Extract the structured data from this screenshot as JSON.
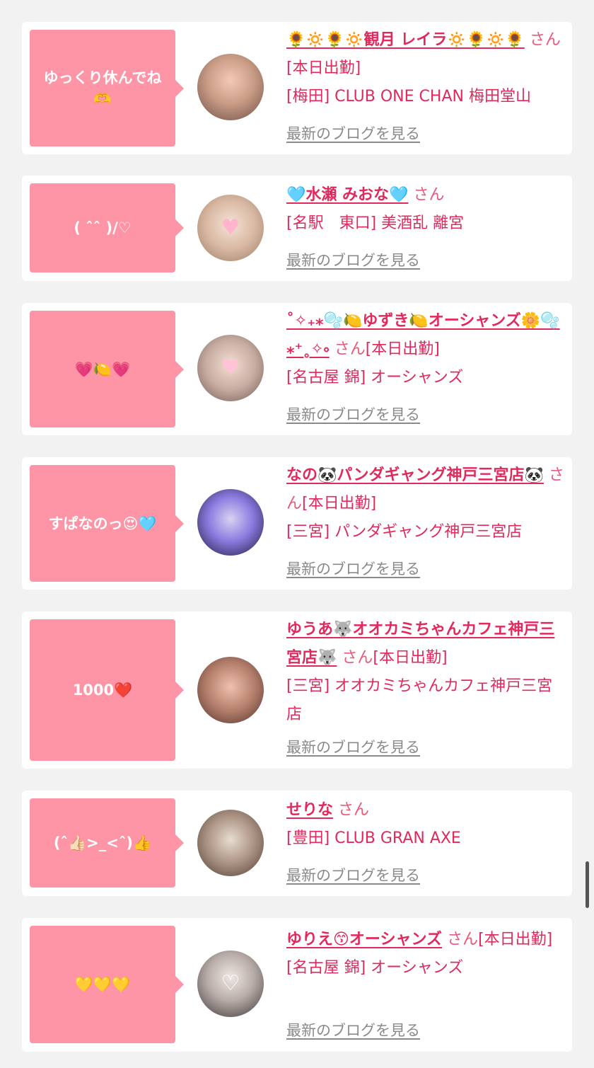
{
  "cards": [
    {
      "bubble": "ゆっくり休んでね🫶",
      "name": "🌻🔅🌻🔅観月 レイラ🔅🌻🔅🌻",
      "suffix": "さん",
      "status": "[本日出勤]",
      "shop": "[梅田] CLUB ONE CHAN 梅田堂山",
      "blog": "最新のブログを見る",
      "avatar_colors": [
        "#f3c9b6",
        "#6b4e45"
      ]
    },
    {
      "bubble": "( ˆˆ )/♡",
      "name": "🩵水瀬 みおな🩵",
      "suffix": "さん",
      "status": "",
      "shop": "[名駅　東口] 美酒乱 離宮",
      "blog": "最新のブログを見る",
      "avatar_colors": [
        "#f6e3d6",
        "#9b7a62"
      ]
    },
    {
      "bubble": "💗🍋💗",
      "name": "˚✧₊⁎🫧🍋ゆずき🍋オーシャンズ🌼🫧⁎⁺˳✧༚",
      "suffix": "さん",
      "status": "[本日出勤]",
      "shop": "[名古屋 錦] オーシャンズ",
      "blog": "最新のブログを見る",
      "avatar_colors": [
        "#f4ded4",
        "#6c5a55"
      ]
    },
    {
      "bubble": "すぱなのっ😍🩵",
      "name": "なの🐼パンダギャング神戸三宮店🐼",
      "suffix": "さん",
      "status": "[本日出勤]",
      "shop": "[三宮] パンダギャング神戸三宮店",
      "blog": "最新のブログを見る",
      "avatar_colors": [
        "#8b7be0",
        "#1c1838"
      ]
    },
    {
      "bubble": "1000❤️",
      "name": "ゆうあ🐺オオカミちゃんカフェ神戸三宮店🐺",
      "suffix": "さん",
      "status": "[本日出勤]",
      "shop": "[三宮] オオカミちゃんカフェ神戸三宮店",
      "blog": "最新のブログを見る",
      "avatar_colors": [
        "#f0c1ad",
        "#4d2f2a"
      ]
    },
    {
      "bubble": "(ˆ👍🏻>_<ˆ)👍",
      "name": "せりな",
      "suffix": "さん",
      "status": "",
      "shop": "[豊田] CLUB GRAN AXE",
      "blog": "最新のブログを見る",
      "avatar_colors": [
        "#d5c0b0",
        "#4a3c34"
      ]
    },
    {
      "bubble": "💛💛💛",
      "name": "ゆりえ😙オーシャンズ",
      "suffix": "さん",
      "status": "[本日出勤]",
      "shop": "[名古屋 錦] オーシャンズ",
      "blog": "最新のブログを見る",
      "avatar_colors": [
        "#efe7e4",
        "#3b3535"
      ]
    }
  ],
  "colors": {
    "bubble": "#fd95a6",
    "link": "#e02a5c",
    "blog_link": "#8a8a8a"
  }
}
